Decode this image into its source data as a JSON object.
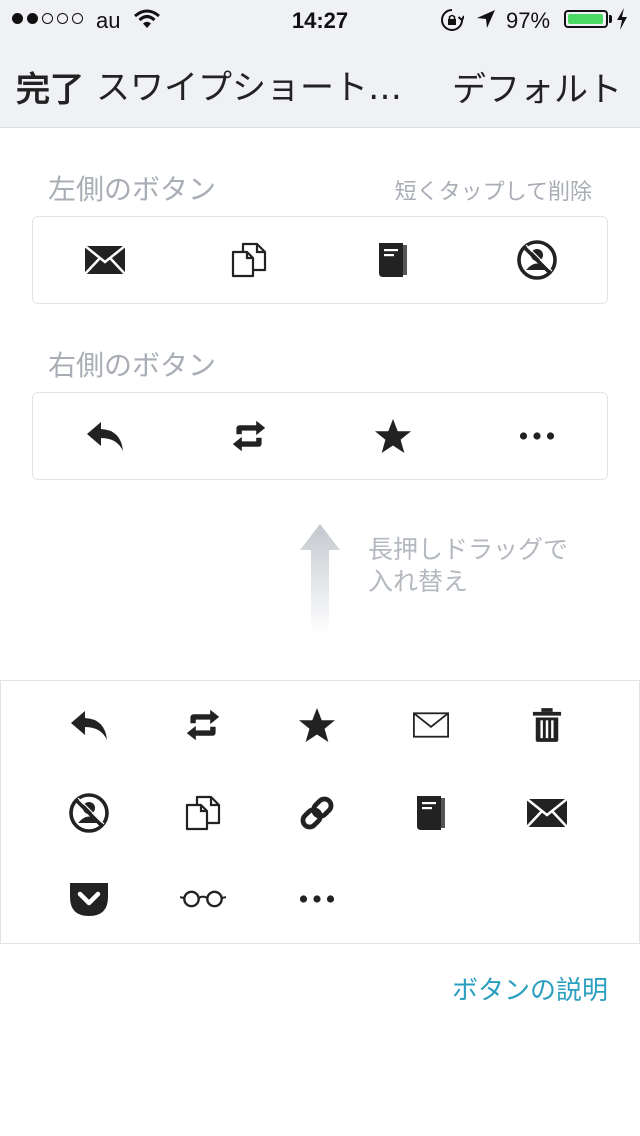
{
  "status_bar": {
    "signal_dots": [
      true,
      true,
      false,
      false,
      false
    ],
    "carrier": "au",
    "time": "14:27",
    "battery_percent": "97%",
    "battery_level": 0.97,
    "icons": [
      "wifi-icon",
      "rotation-lock-icon",
      "location-arrow-icon",
      "battery-icon",
      "charging-bolt-icon"
    ]
  },
  "nav": {
    "done_label": "完了",
    "title": "スワイプショート…",
    "default_label": "デフォルト"
  },
  "left_section": {
    "title": "左側のボタン",
    "hint": "短くタップして削除",
    "buttons": [
      "mail-icon",
      "copy-icon",
      "book-icon",
      "no-person-icon"
    ]
  },
  "right_section": {
    "title": "右側のボタン",
    "buttons": [
      "reply-icon",
      "retweet-icon",
      "star-icon",
      "more-icon"
    ]
  },
  "drag_hint": {
    "line1": "長押しドラッグで",
    "line2": "入れ替え"
  },
  "palette": {
    "items": [
      "reply-icon",
      "retweet-icon",
      "star-icon",
      "mail-outline-icon",
      "trash-icon",
      "no-person-icon",
      "copy-icon",
      "link-icon",
      "book-icon",
      "mail-icon",
      "pocket-icon",
      "glasses-icon",
      "more-icon"
    ]
  },
  "footer": {
    "explain_link": "ボタンの説明"
  },
  "colors": {
    "accent": "#2a9fc0",
    "label_gray": "#a9adb5",
    "battery_green": "#4cd964",
    "bar_background": "#f0f1f5"
  }
}
